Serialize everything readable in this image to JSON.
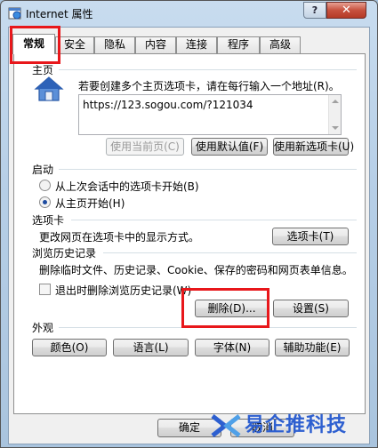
{
  "window": {
    "title": "Internet 属性",
    "help_label": "?",
    "close_label": "✕"
  },
  "tabs": [
    {
      "label": "常规"
    },
    {
      "label": "安全"
    },
    {
      "label": "隐私"
    },
    {
      "label": "内容"
    },
    {
      "label": "连接"
    },
    {
      "label": "程序"
    },
    {
      "label": "高级"
    }
  ],
  "homepage": {
    "section_title": "主页",
    "instruction": "若要创建多个主页选项卡，请在每行输入一个地址(R)。",
    "url": "https://123.sogou.com/?121034",
    "btn_current": "使用当前页(C)",
    "btn_default": "使用默认值(F)",
    "btn_new_tab": "使用新选项卡(U)"
  },
  "startup": {
    "section_title": "启动",
    "option_last_session": "从上次会话中的选项卡开始(B)",
    "option_home": "从主页开始(H)",
    "selected": "option_home"
  },
  "tabs_section": {
    "section_title": "选项卡",
    "description": "更改网页在选项卡中的显示方式。",
    "button": "选项卡(T)"
  },
  "history": {
    "section_title": "浏览历史记录",
    "description": "删除临时文件、历史记录、Cookie、保存的密码和网页表单信息。",
    "checkbox_label": "退出时删除浏览历史记录(W)",
    "btn_delete": "删除(D)...",
    "btn_settings": "设置(S)"
  },
  "appearance": {
    "section_title": "外观",
    "btn_colors": "颜色(O)",
    "btn_languages": "语言(L)",
    "btn_fonts": "字体(N)",
    "btn_accessibility": "辅助功能(E)"
  },
  "footer": {
    "btn_ok": "确定",
    "btn_cancel": "取消"
  },
  "watermark": {
    "text": "易企推科技"
  },
  "colors": {
    "highlight": "#e8171b",
    "accent": "#1d4ba0"
  }
}
